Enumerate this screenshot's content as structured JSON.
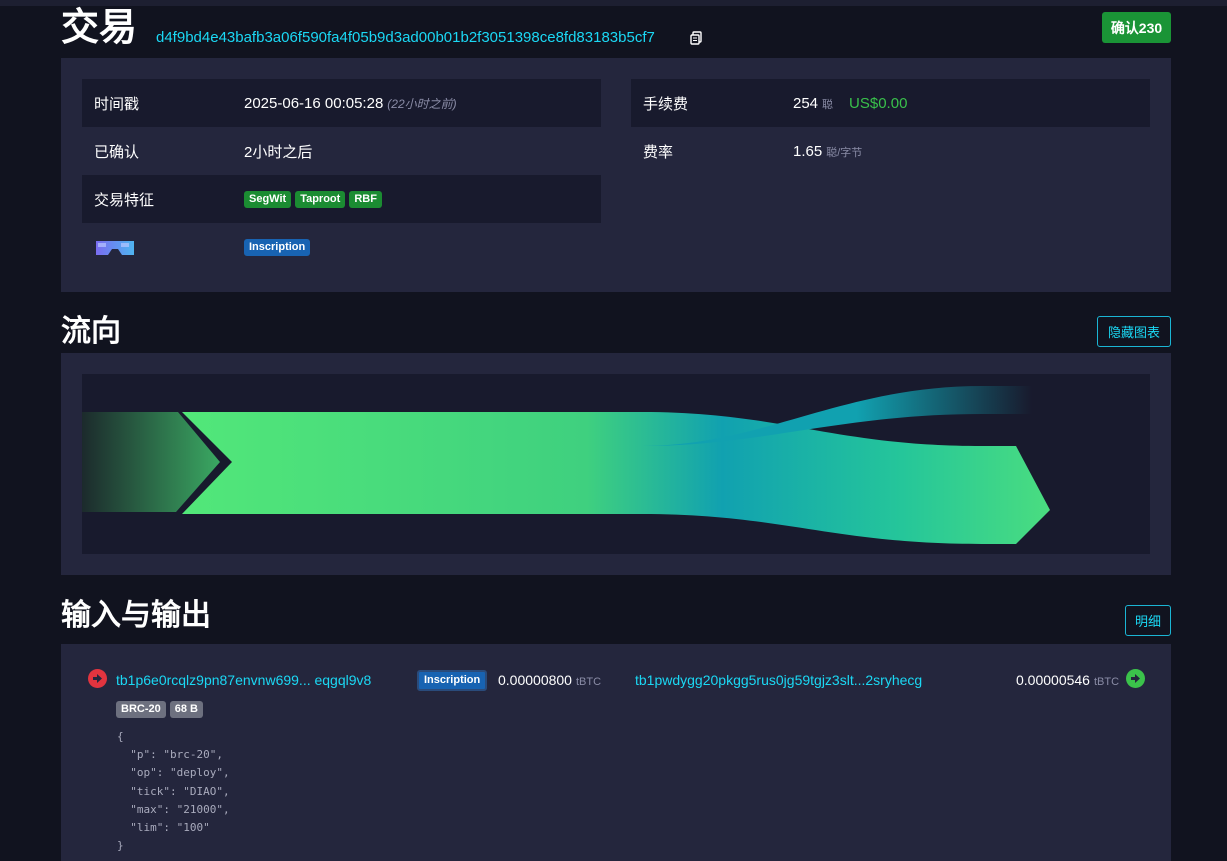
{
  "header": {
    "title": "交易",
    "txid": "d4f9bd4e43bafb3a06f590fa4f05b9d3ad00b01b2f3051398ce8fd83183b5cf7",
    "confirmations": "确认230"
  },
  "details": {
    "timestamp_label": "时间戳",
    "timestamp_value": "2025-06-16 00:05:28",
    "timestamp_relative": "(22小时之前)",
    "confirmed_label": "已确认",
    "confirmed_value": "2小时之后",
    "features_label": "交易特征",
    "features": [
      "SegWit",
      "Taproot",
      "RBF"
    ],
    "inscription_tag": "Inscription",
    "fee_label": "手续费",
    "fee_value": "254",
    "fee_unit": "聪",
    "fee_usd": "US$0.00",
    "feerate_label": "费率",
    "feerate_value": "1.65",
    "feerate_unit": "聪/字节"
  },
  "flow": {
    "title": "流向",
    "hide_button": "隐藏图表"
  },
  "io": {
    "title": "输入与输出",
    "details_button": "明细",
    "input": {
      "address": "tb1p6e0rcqlz9pn87envnw699... eqgql9v8",
      "tag": "Inscription",
      "amount": "0.00000800",
      "unit": "tBTC",
      "badges": [
        "BRC-20",
        "68 B"
      ],
      "json": "{\n  \"p\": \"brc-20\",\n  \"op\": \"deploy\",\n  \"tick\": \"DIAO\",\n  \"max\": \"21000\",\n  \"lim\": \"100\"\n}"
    },
    "output": {
      "address": "tb1pwdygg20pkgg5rus0jg59tgjz3slt...2sryhecg",
      "amount": "0.00000546",
      "unit": "tBTC"
    }
  },
  "colors": {
    "background": "#11131f",
    "panel": "#24263d",
    "accent_cyan": "#1bd8f4",
    "green": "#1a9436",
    "blue_tag": "#1863b2",
    "input_red": "#e2343f",
    "output_green": "#3bc24b"
  }
}
